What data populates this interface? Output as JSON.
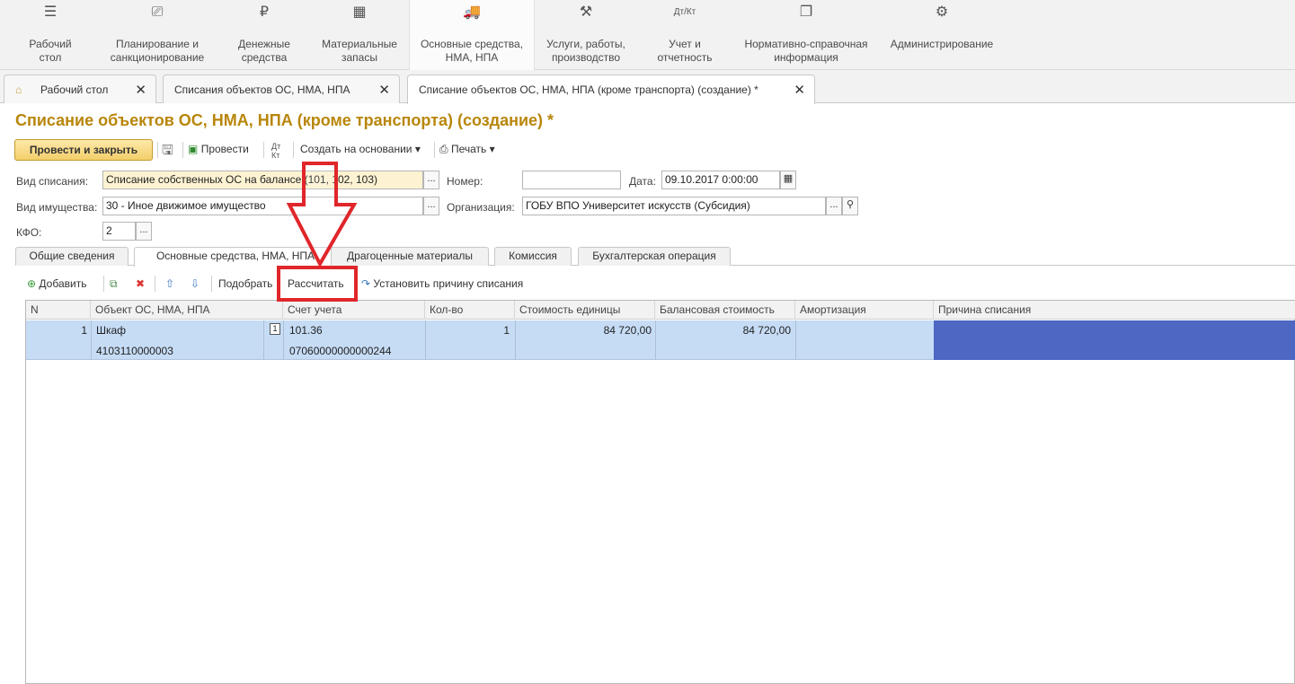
{
  "sections": [
    {
      "icon": "menu-icon",
      "glyph": "☰",
      "label_1": "Рабочий",
      "label_2": "стол"
    },
    {
      "icon": "planning-icon",
      "glyph": "⎚",
      "label_1": "Планирование и",
      "label_2": "санкционирование"
    },
    {
      "icon": "ruble-icon",
      "glyph": "₽",
      "label_1": "Денежные",
      "label_2": "средства"
    },
    {
      "icon": "grid-icon",
      "glyph": "▦",
      "label_1": "Материальные",
      "label_2": "запасы"
    },
    {
      "icon": "truck-icon",
      "glyph": "🚚",
      "label_1": "Основные средства,",
      "label_2": "НМА, НПА"
    },
    {
      "icon": "tools-icon",
      "glyph": "⚒",
      "label_1": "Услуги, работы,",
      "label_2": "производство"
    },
    {
      "icon": "dt-kt-icon",
      "glyph": "Дт/Кт",
      "label_1": "Учет и",
      "label_2": "отчетность"
    },
    {
      "icon": "books-icon",
      "glyph": "❐",
      "label_1": "Нормативно-справочная",
      "label_2": "информация"
    },
    {
      "icon": "gear-icon",
      "glyph": "⚙",
      "label_1": "Администрирование",
      "label_2": ""
    }
  ],
  "window_tabs": [
    {
      "label": "Рабочий стол"
    },
    {
      "label": "Списания объектов ОС, НМА, НПА"
    },
    {
      "label": "Списание объектов ОС, НМА, НПА (кроме транспорта) (создание) *"
    }
  ],
  "form": {
    "title": "Списание объектов ОС, НМА, НПА (кроме транспорта) (создание) *",
    "commands": {
      "post_close": "Провести и закрыть",
      "post": "Провести",
      "create_based": "Создать на основании",
      "print": "Печать"
    },
    "fields": {
      "writeoff_type_label": "Вид списания:",
      "writeoff_type_value": "Списание собственных ОС на балансе (101, 102, 103)",
      "number_label": "Номер:",
      "number_value": "",
      "date_label": "Дата:",
      "date_value": "09.10.2017  0:00:00",
      "property_type_label": "Вид имущества:",
      "property_type_value": "30 - Иное движимое имущество",
      "org_label": "Организация:",
      "org_value": "ГОБУ ВПО Университет искусств (Субсидия)",
      "kfo_label": "КФО:",
      "kfo_value": "2"
    },
    "tabs": [
      "Общие сведения",
      "Основные средства, НМА, НПА",
      "Драгоценные материалы",
      "Комиссия",
      "Бухгалтерская операция"
    ],
    "table_tools": {
      "add": "Добавить",
      "pick": "Подобрать",
      "calculate": "Рассчитать",
      "set_reason": "Установить причину списания"
    },
    "grid": {
      "columns": [
        "N",
        "Объект ОС, НМА, НПА",
        "Счет учета",
        "Кол-во",
        "Стоимость единицы",
        "Балансовая стоимость",
        "Амортизация",
        "Причина списания"
      ],
      "rows": [
        {
          "n": "1",
          "object": "Шкаф",
          "object_code": "4103110000003",
          "indicator": "1",
          "account": "101.36",
          "account_code": "07060000000000244",
          "qty": "1",
          "unit_cost": "84 720,00",
          "balance_cost": "84 720,00",
          "amortization": "",
          "reason": ""
        }
      ]
    }
  },
  "colors": {
    "title": "#b8860b",
    "highlight": "#e0262a",
    "selected_row": "#c6dcf5",
    "selected_cell": "#4d67c2"
  }
}
